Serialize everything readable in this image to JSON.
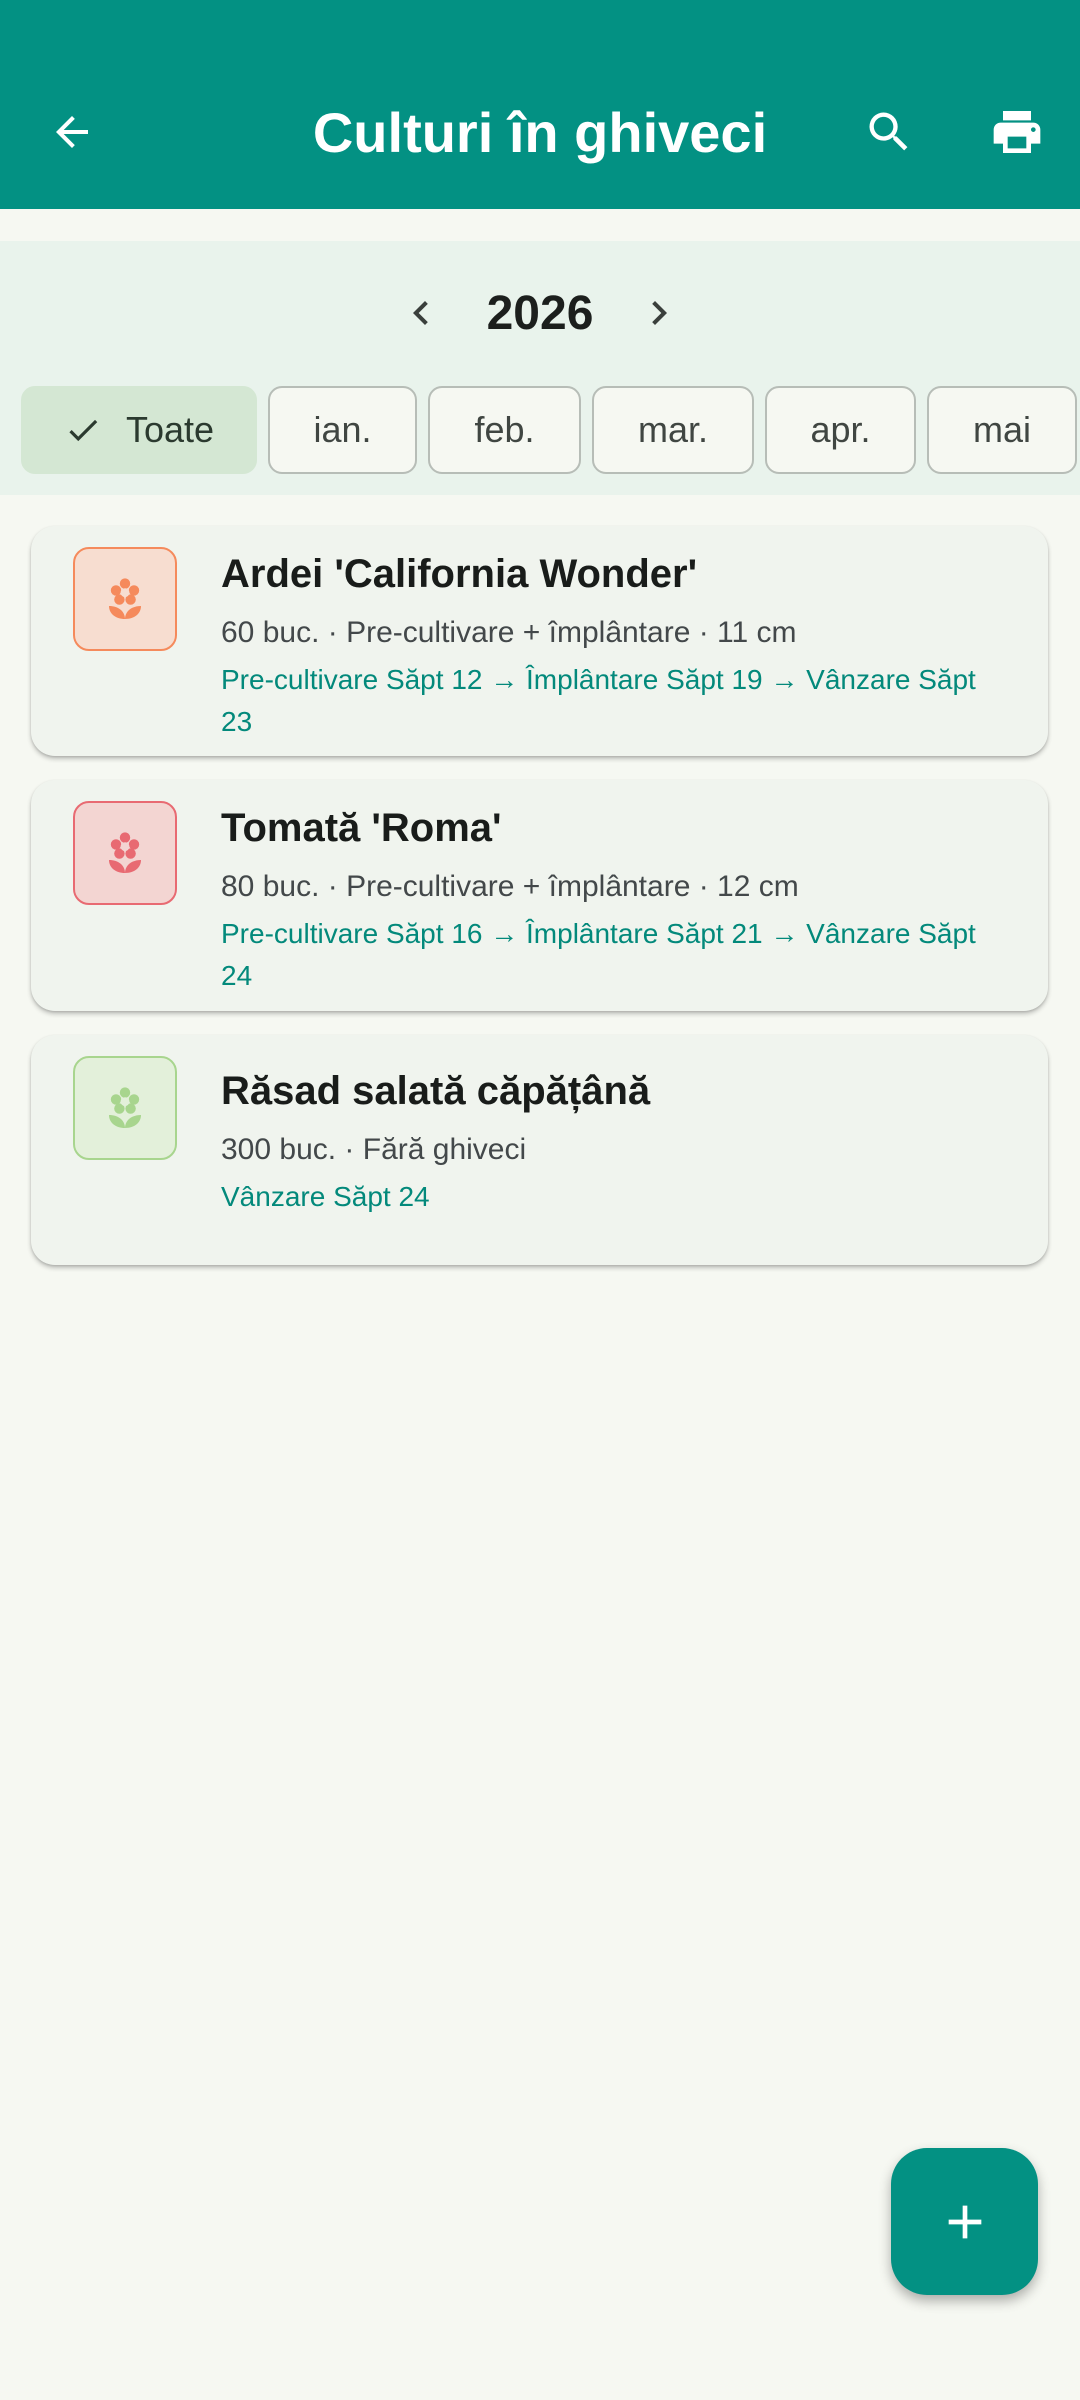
{
  "colors": {
    "primary": "#039183",
    "background": "#F6F8F2",
    "filter_background": "#E9F3EC",
    "chip_selected": "#D4E7D3",
    "schedule_text": "#03897B"
  },
  "appbar": {
    "title": "Culturi în ghiveci",
    "back_icon": "arrow-back-icon",
    "search_icon": "search-icon",
    "print_icon": "print-icon"
  },
  "year_selector": {
    "year": "2026",
    "prev_icon": "chevron-left-icon",
    "next_icon": "chevron-right-icon"
  },
  "month_chips": [
    {
      "label": "Toate",
      "selected": true
    },
    {
      "label": "ian.",
      "selected": false
    },
    {
      "label": "feb.",
      "selected": false
    },
    {
      "label": "mar.",
      "selected": false
    },
    {
      "label": "apr.",
      "selected": false
    },
    {
      "label": "mai",
      "selected": false
    }
  ],
  "crops": [
    {
      "name": "Ardei 'California Wonder'",
      "meta": "60 buc. · Pre-cultivare + împlântare · 11 cm",
      "schedule": "Pre-cultivare Săpt 12 → Împlântare Săpt 19 → Vânzare Săpt 23",
      "icon": "flower-icon",
      "color": "#F58A5C",
      "bg": "#F7DDD0"
    },
    {
      "name": "Tomată 'Roma'",
      "meta": "80 buc. · Pre-cultivare + împlântare · 12 cm",
      "schedule": "Pre-cultivare Săpt 16 → Împlântare Săpt 21 → Vânzare Săpt 24",
      "icon": "flower-icon",
      "color": "#E86A72",
      "bg": "#F3D5D2"
    },
    {
      "name": "Răsad salată căpățână",
      "meta": "300 buc. · Fără ghiveci",
      "schedule": "Vânzare Săpt 24",
      "icon": "flower-icon",
      "color": "#A8D58E",
      "bg": "#E3F0DA"
    }
  ],
  "fab": {
    "icon": "plus-icon"
  }
}
